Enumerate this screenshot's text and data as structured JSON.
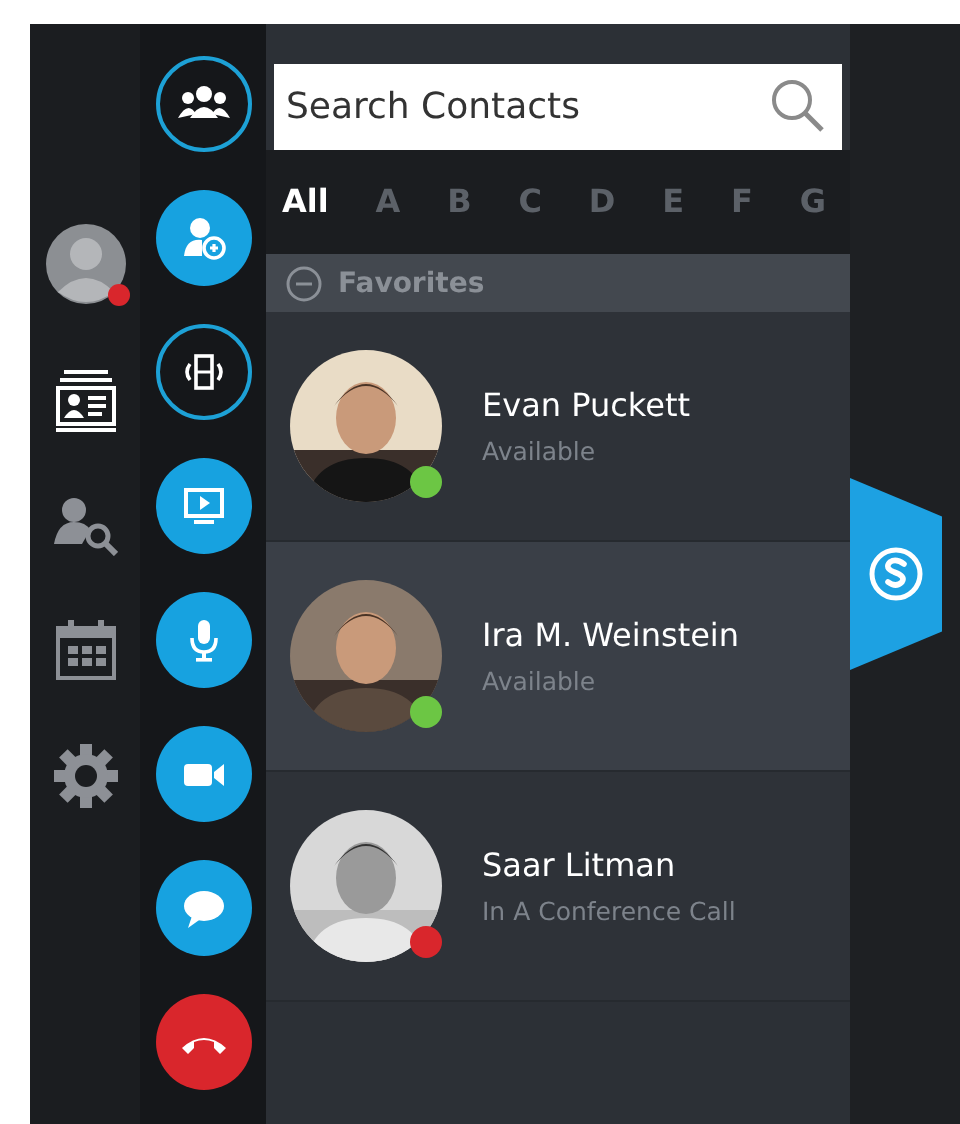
{
  "profile": {
    "color": "#d9262c"
  },
  "nav": [
    {
      "selected": true
    },
    {
      "selected": false
    },
    {
      "selected": false
    },
    {
      "selected": false
    }
  ],
  "actions": [
    {
      "kind": "outline"
    },
    {
      "kind": "filled"
    },
    {
      "kind": "outline"
    },
    {
      "kind": "filled"
    },
    {
      "kind": "filled"
    },
    {
      "kind": "filled"
    },
    {
      "kind": "filled"
    },
    {
      "kind": "end"
    }
  ],
  "search": {
    "placeholder": "Search Contacts"
  },
  "letters": [
    {
      "label": "All",
      "selected": true
    },
    {
      "label": "A",
      "selected": false
    },
    {
      "label": "B",
      "selected": false
    },
    {
      "label": "C",
      "selected": false
    },
    {
      "label": "D",
      "selected": false
    },
    {
      "label": "E",
      "selected": false
    },
    {
      "label": "F",
      "selected": false
    },
    {
      "label": "G",
      "selected": false
    }
  ],
  "group": {
    "label": "Favorites",
    "expanded": true
  },
  "contacts": [
    {
      "name": "Evan Puckett",
      "status": "Available",
      "color": "#6cc644",
      "selected": false,
      "kind": "picture"
    },
    {
      "name": "Ira M. Weinstein",
      "status": "Available",
      "color": "#6cc644",
      "selected": true,
      "kind": "picture"
    },
    {
      "name": "Saar Litman",
      "status": "In A Conference Call",
      "color": "#d9262c",
      "selected": false,
      "kind": "picture"
    }
  ]
}
